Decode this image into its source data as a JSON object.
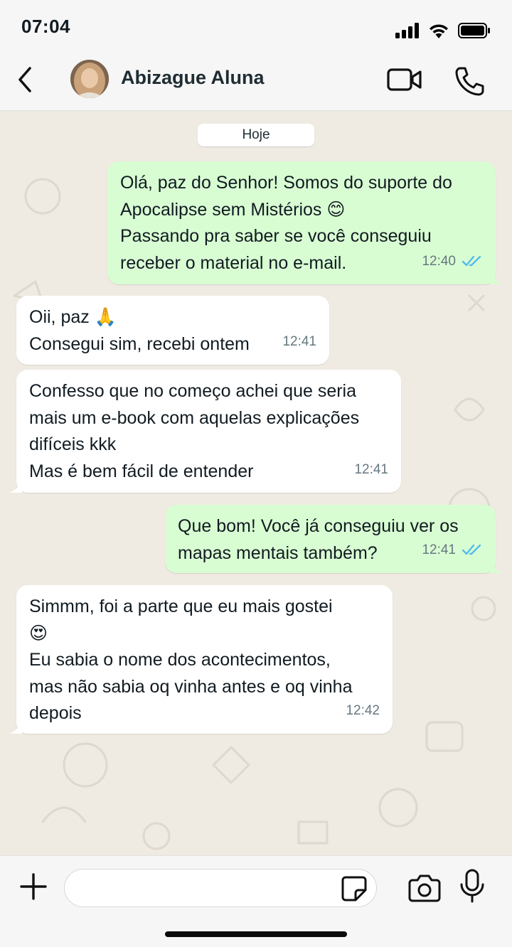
{
  "status_bar": {
    "time": "07:04"
  },
  "header": {
    "contact_name": "Abizague Aluna"
  },
  "chat": {
    "date_label": "Hoje",
    "messages": [
      {
        "direction": "out",
        "text": "Olá, paz do Senhor! Somos do suporte do\nApocalipse sem Mistérios 😊\nPassando pra saber se você conseguiu\nreceber o material no e-mail.",
        "time": "12:40",
        "status": "read"
      },
      {
        "direction": "in",
        "text": "Oii, paz 🙏\nConsegui sim, recebi ontem",
        "time": "12:41"
      },
      {
        "direction": "in",
        "text": "Confesso que no começo achei que seria\nmais um e-book com aquelas explicações\ndifíceis kkk\nMas é bem fácil de entender",
        "time": "12:41"
      },
      {
        "direction": "out",
        "text": "Que bom! Você já conseguiu ver os\nmapas mentais também?",
        "time": "12:41",
        "status": "read"
      },
      {
        "direction": "in",
        "text": "Simmm, foi a parte que eu mais gostei\n😍\nEu sabia o nome dos acontecimentos,\nmas não sabia oq vinha antes e oq vinha\ndepois",
        "time": "12:42"
      }
    ]
  },
  "input": {
    "value": "",
    "placeholder": ""
  },
  "colors": {
    "outgoing_bubble": "#d9fdd3",
    "incoming_bubble": "#ffffff",
    "read_ticks": "#53bdeb",
    "chat_background": "#efeae2"
  }
}
